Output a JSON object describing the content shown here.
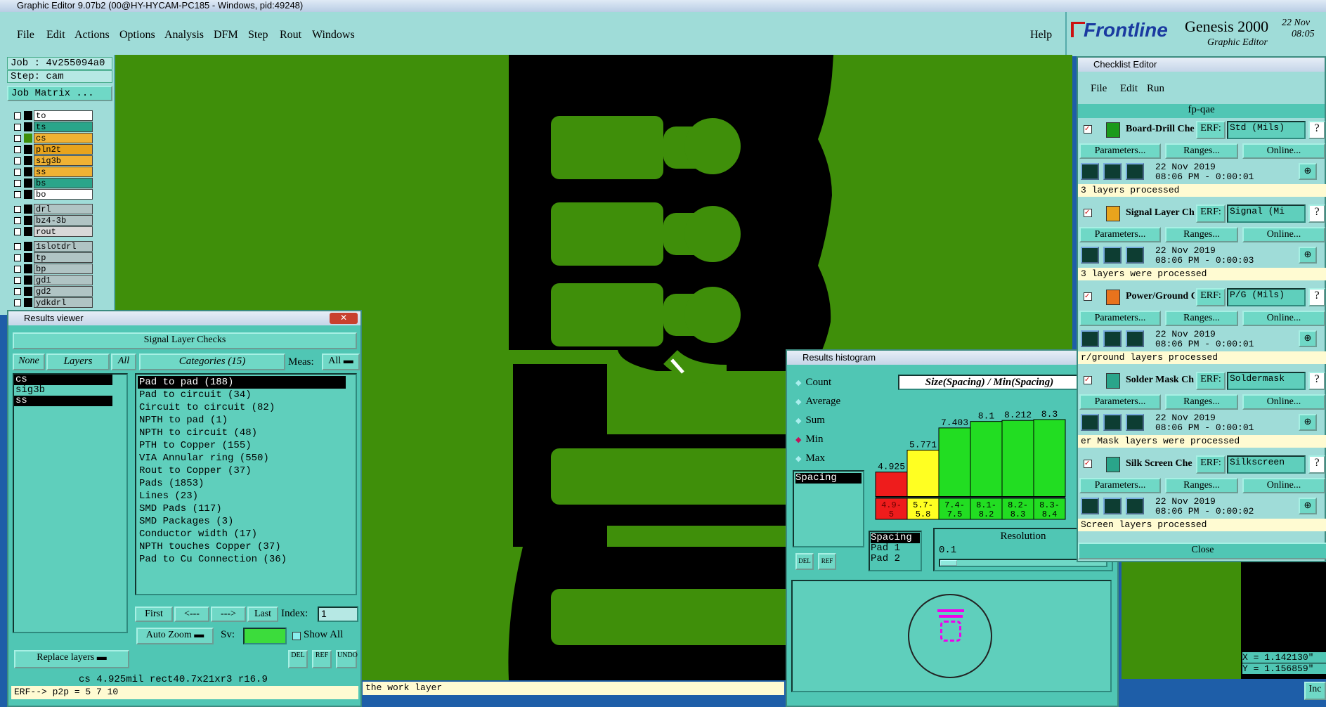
{
  "app_title": "Graphic Editor 9.07b2 (00@HY-HYCAM-PC185 - Windows, pid:49248)",
  "menu": {
    "file": "File",
    "edit": "Edit",
    "actions": "Actions",
    "options": "Options",
    "analysis": "Analysis",
    "dfm": "DFM",
    "step": "Step",
    "rout": "Rout",
    "windows": "Windows",
    "help": "Help"
  },
  "brand": {
    "logo": "Frontline",
    "product": "Genesis 2000",
    "subtitle": "Graphic Editor",
    "date": "22 Nov",
    "time": "08:05"
  },
  "job": {
    "job": "Job : 4v255094a0",
    "step": "Step: cam",
    "matrix": "Job Matrix ..."
  },
  "layers": [
    {
      "name": "to",
      "color": "#ffffff",
      "sw": "#000000"
    },
    {
      "name": "ts",
      "color": "#2aa58a",
      "sw": "#000000"
    },
    {
      "name": "cs",
      "color": "#f0b233",
      "sw": "#3f8f0a"
    },
    {
      "name": "pln2t",
      "color": "#e8a41d",
      "sw": "#000000"
    },
    {
      "name": "sig3b",
      "color": "#f0b233",
      "sw": "#000000"
    },
    {
      "name": "ss",
      "color": "#f0b233",
      "sw": "#000000"
    },
    {
      "name": "bs",
      "color": "#2aa58a",
      "sw": "#000000"
    },
    {
      "name": "bo",
      "color": "#ffffff",
      "sw": "#000000"
    },
    {
      "name": "drl",
      "color": "#b0c4c4",
      "sw": "#000000"
    },
    {
      "name": "bz4-3b",
      "color": "#b0c4c4",
      "sw": "#000000"
    },
    {
      "name": "rout",
      "color": "#d8d8d8",
      "sw": "#000000"
    },
    {
      "name": "1slotdrl",
      "color": "#b0c4c4",
      "sw": "#000000"
    },
    {
      "name": "tp",
      "color": "#b0c4c4",
      "sw": "#000000"
    },
    {
      "name": "bp",
      "color": "#b0c4c4",
      "sw": "#000000"
    },
    {
      "name": "gd1",
      "color": "#b0c4c4",
      "sw": "#000000"
    },
    {
      "name": "gd2",
      "color": "#b0c4c4",
      "sw": "#000000"
    },
    {
      "name": "ydkdrl",
      "color": "#b0c4c4",
      "sw": "#000000"
    }
  ],
  "results_viewer": {
    "title": "Results viewer",
    "header": "Signal Layer Checks",
    "none": "None",
    "layers": "Layers",
    "all": "All",
    "categories": "Categories (15)",
    "meas": "Meas:",
    "meas_value": "All",
    "layer_list": [
      "cs",
      "sig3b",
      "ss"
    ],
    "category_list": [
      "Pad to pad (188)",
      "Pad to circuit (34)",
      "Circuit to circuit (82)",
      "NPTH to pad (1)",
      "NPTH to circuit (48)",
      "PTH to Copper (155)",
      "VIA Annular ring (550)",
      "Rout to Copper (37)",
      "Pads (1853)",
      "Lines (23)",
      "SMD Pads (117)",
      "SMD Packages (3)",
      "Conductor width (17)",
      "NPTH touches Copper (37)",
      "Pad to Cu Connection (36)"
    ],
    "first": "First",
    "prev": "<---",
    "next": "--->",
    "last": "Last",
    "index_label": "Index:",
    "index_value": "1",
    "auto_zoom": "Auto Zoom",
    "sv": "Sv:",
    "show_all": "Show All",
    "replace": "Replace layers",
    "del": "DEL",
    "ref": "REF",
    "undo": "UNDO",
    "info": "cs 4.925mil  rect40.7x21xr3  r16.9"
  },
  "status_erf": "ERF--> p2p = 5 7 10",
  "status_msg": "the work layer",
  "histogram": {
    "title": "Results histogram",
    "options": [
      "Count",
      "Average",
      "Sum",
      "Min",
      "Max"
    ],
    "selected_option": "Min",
    "measure_list": [
      "Spacing"
    ],
    "chart_title": "Size(Spacing) / Min(Spacing)",
    "sel_list": [
      "Spacing",
      "Pad 1",
      "Pad 2"
    ],
    "resolution_label": "Resolution",
    "resolution_value": "0.1",
    "del": "DEL",
    "ref": "REF"
  },
  "chart_data": {
    "type": "bar",
    "title": "Size(Spacing) / Min(Spacing)",
    "categories": [
      "4.9-5",
      "5.7-5.8",
      "7.4-7.5",
      "8.1-8.2",
      "8.2-8.3",
      "8.3-8.4"
    ],
    "values": [
      4.925,
      5.771,
      7.403,
      8.1,
      8.212,
      8.3
    ],
    "value_labels": [
      "4.925",
      "5.771",
      "7.403",
      "8.1",
      "8.212",
      "8.3"
    ],
    "colors": [
      "#ee1c1c",
      "#ffff22",
      "#22dd22",
      "#22dd22",
      "#22dd22",
      "#22dd22"
    ],
    "ylim": [
      0,
      8.3
    ]
  },
  "checklist": {
    "title": "Checklist Editor",
    "file": "File",
    "edit": "Edit",
    "run": "Run",
    "name": "fp-qae",
    "erf": "ERF:",
    "params": "Parameters...",
    "ranges": "Ranges...",
    "online": "Online...",
    "close": "Close",
    "items": [
      {
        "name": "Board-Drill Che",
        "erf": "Std (Mils)",
        "date": "22 Nov 2019",
        "time": "08:06 PM - 0:00:01",
        "msg": "3 layers processed"
      },
      {
        "name": "Signal Layer Ch",
        "erf": "Signal (Mi",
        "date": "22 Nov 2019",
        "time": "08:06 PM - 0:00:03",
        "msg": "3 layers were processed"
      },
      {
        "name": "Power/Ground C",
        "erf": "P/G (Mils)",
        "date": "22 Nov 2019",
        "time": "08:06 PM - 0:00:01",
        "msg": "r/ground layers processed"
      },
      {
        "name": "Solder Mask Ch",
        "erf": "Soldermask",
        "date": "22 Nov 2019",
        "time": "08:06 PM - 0:00:01",
        "msg": "er Mask layers were processed"
      },
      {
        "name": "Silk Screen Che",
        "erf": "Silkscreen",
        "date": "22 Nov 2019",
        "time": "08:06 PM - 0:00:02",
        "msg": "Screen layers processed"
      }
    ]
  },
  "coords": {
    "x": "X = 1.142130\"",
    "y": "Y = 1.156859\""
  },
  "inc": "Inc"
}
